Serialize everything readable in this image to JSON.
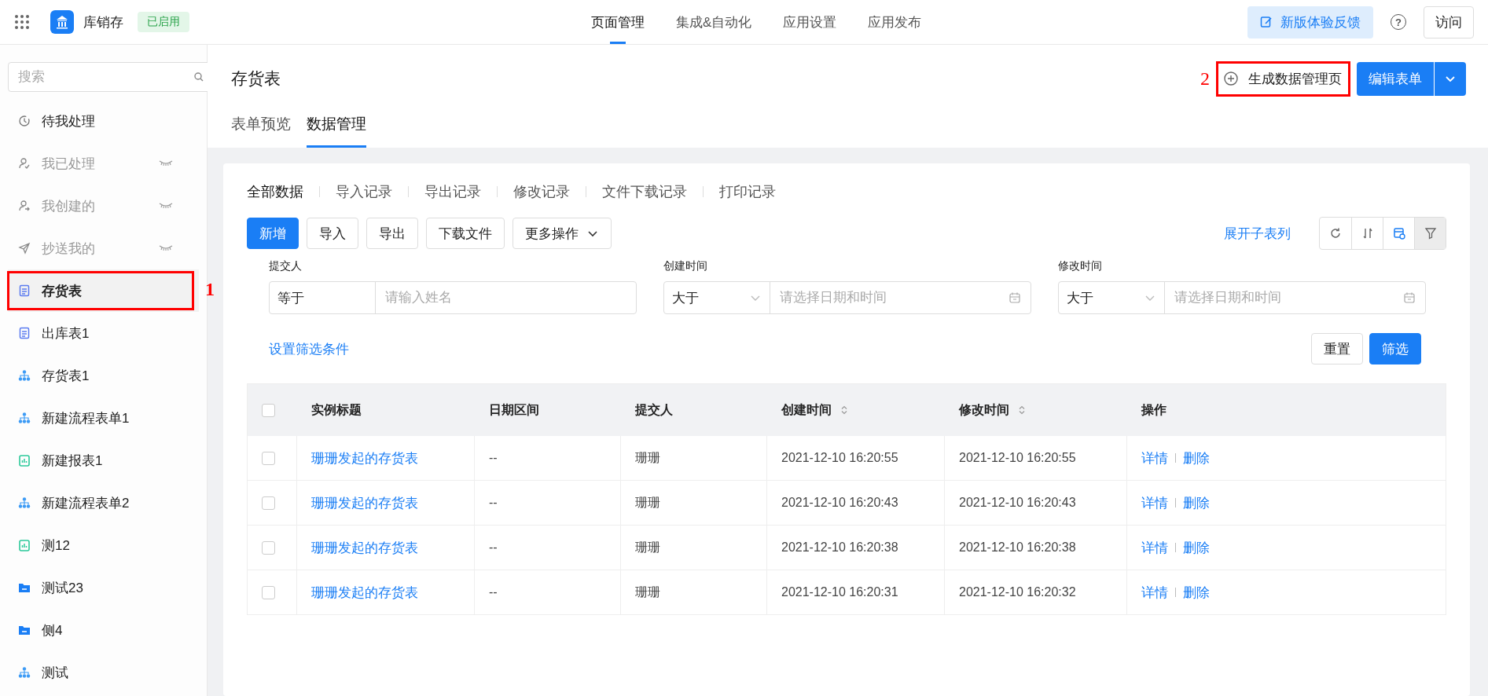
{
  "topbar": {
    "app_name": "库销存",
    "status_badge": "已启用",
    "nav": [
      {
        "label": "页面管理",
        "selected": true
      },
      {
        "label": "集成&自动化",
        "selected": false
      },
      {
        "label": "应用设置",
        "selected": false
      },
      {
        "label": "应用发布",
        "selected": false
      }
    ],
    "feedback_button": "新版体验反馈",
    "help_icon": "?",
    "visit_button": "访问"
  },
  "sidebar": {
    "search": {
      "placeholder": "搜索"
    },
    "items": [
      {
        "label": "待我处理",
        "kind": "clock",
        "hidden": false,
        "selected": false
      },
      {
        "label": "我已处理",
        "kind": "user-check",
        "hidden": true,
        "selected": false
      },
      {
        "label": "我创建的",
        "kind": "user-arrow",
        "hidden": true,
        "selected": false
      },
      {
        "label": "抄送我的",
        "kind": "send",
        "hidden": true,
        "selected": false
      },
      {
        "label": "存货表",
        "kind": "form",
        "hidden": false,
        "selected": true,
        "annotation": "1"
      },
      {
        "label": "出库表1",
        "kind": "form",
        "hidden": false,
        "selected": false
      },
      {
        "label": "存货表1",
        "kind": "flow",
        "hidden": false,
        "selected": false
      },
      {
        "label": "新建流程表单1",
        "kind": "flow",
        "hidden": false,
        "selected": false
      },
      {
        "label": "新建报表1",
        "kind": "report",
        "hidden": false,
        "selected": false
      },
      {
        "label": "新建流程表单2",
        "kind": "flow",
        "hidden": false,
        "selected": false
      },
      {
        "label": "测12",
        "kind": "report",
        "hidden": false,
        "selected": false
      },
      {
        "label": "测试23",
        "kind": "folder",
        "hidden": false,
        "selected": false
      },
      {
        "label": "侧4",
        "kind": "folder",
        "hidden": false,
        "selected": false
      },
      {
        "label": "测试",
        "kind": "flow",
        "hidden": false,
        "selected": false
      }
    ]
  },
  "page": {
    "title": "存货表",
    "tabs": [
      {
        "label": "表单预览",
        "selected": false
      },
      {
        "label": "数据管理",
        "selected": true
      }
    ],
    "generate_button": {
      "label": "生成数据管理页",
      "annotation": "2"
    },
    "edit_button": "编辑表单"
  },
  "data_tabs": [
    {
      "label": "全部数据",
      "selected": true
    },
    {
      "label": "导入记录",
      "selected": false
    },
    {
      "label": "导出记录",
      "selected": false
    },
    {
      "label": "修改记录",
      "selected": false
    },
    {
      "label": "文件下载记录",
      "selected": false
    },
    {
      "label": "打印记录",
      "selected": false
    }
  ],
  "actions": [
    {
      "label": "新增",
      "primary": true
    },
    {
      "label": "导入",
      "primary": false
    },
    {
      "label": "导出",
      "primary": false
    },
    {
      "label": "下载文件",
      "primary": false
    },
    {
      "label": "更多操作",
      "primary": false,
      "dropdown": true
    }
  ],
  "expand_link": "展开子表列",
  "filters": [
    {
      "label": "提交人",
      "operator": "等于",
      "operator_dropdown": false,
      "placeholder": "请输入姓名",
      "date": false
    },
    {
      "label": "创建时间",
      "operator": "大于",
      "operator_dropdown": true,
      "placeholder": "请选择日期和时间",
      "date": true
    },
    {
      "label": "修改时间",
      "operator": "大于",
      "operator_dropdown": true,
      "placeholder": "请选择日期和时间",
      "date": true
    }
  ],
  "filter_settings_link": "设置筛选条件",
  "reset_button": "重置",
  "filter_button": "筛选",
  "table": {
    "header_checked": false,
    "columns": [
      {
        "label": "实例标题"
      },
      {
        "label": "日期区间"
      },
      {
        "label": "提交人"
      },
      {
        "label": "创建时间",
        "sortable": true
      },
      {
        "label": "修改时间",
        "sortable": true
      },
      {
        "label": "操作"
      }
    ],
    "rows": [
      {
        "checked": false,
        "title": "珊珊发起的存货表",
        "date_range": "--",
        "submitter": "珊珊",
        "created": "2021-12-10 16:20:55",
        "modified": "2021-12-10 16:20:55",
        "detail": "详情",
        "delete": "删除"
      },
      {
        "checked": false,
        "title": "珊珊发起的存货表",
        "date_range": "--",
        "submitter": "珊珊",
        "created": "2021-12-10 16:20:43",
        "modified": "2021-12-10 16:20:43",
        "detail": "详情",
        "delete": "删除"
      },
      {
        "checked": false,
        "title": "珊珊发起的存货表",
        "date_range": "--",
        "submitter": "珊珊",
        "created": "2021-12-10 16:20:38",
        "modified": "2021-12-10 16:20:38",
        "detail": "详情",
        "delete": "删除"
      },
      {
        "checked": false,
        "title": "珊珊发起的存货表",
        "date_range": "--",
        "submitter": "珊珊",
        "created": "2021-12-10 16:20:31",
        "modified": "2021-12-10 16:20:32",
        "detail": "详情",
        "delete": "删除"
      }
    ]
  }
}
